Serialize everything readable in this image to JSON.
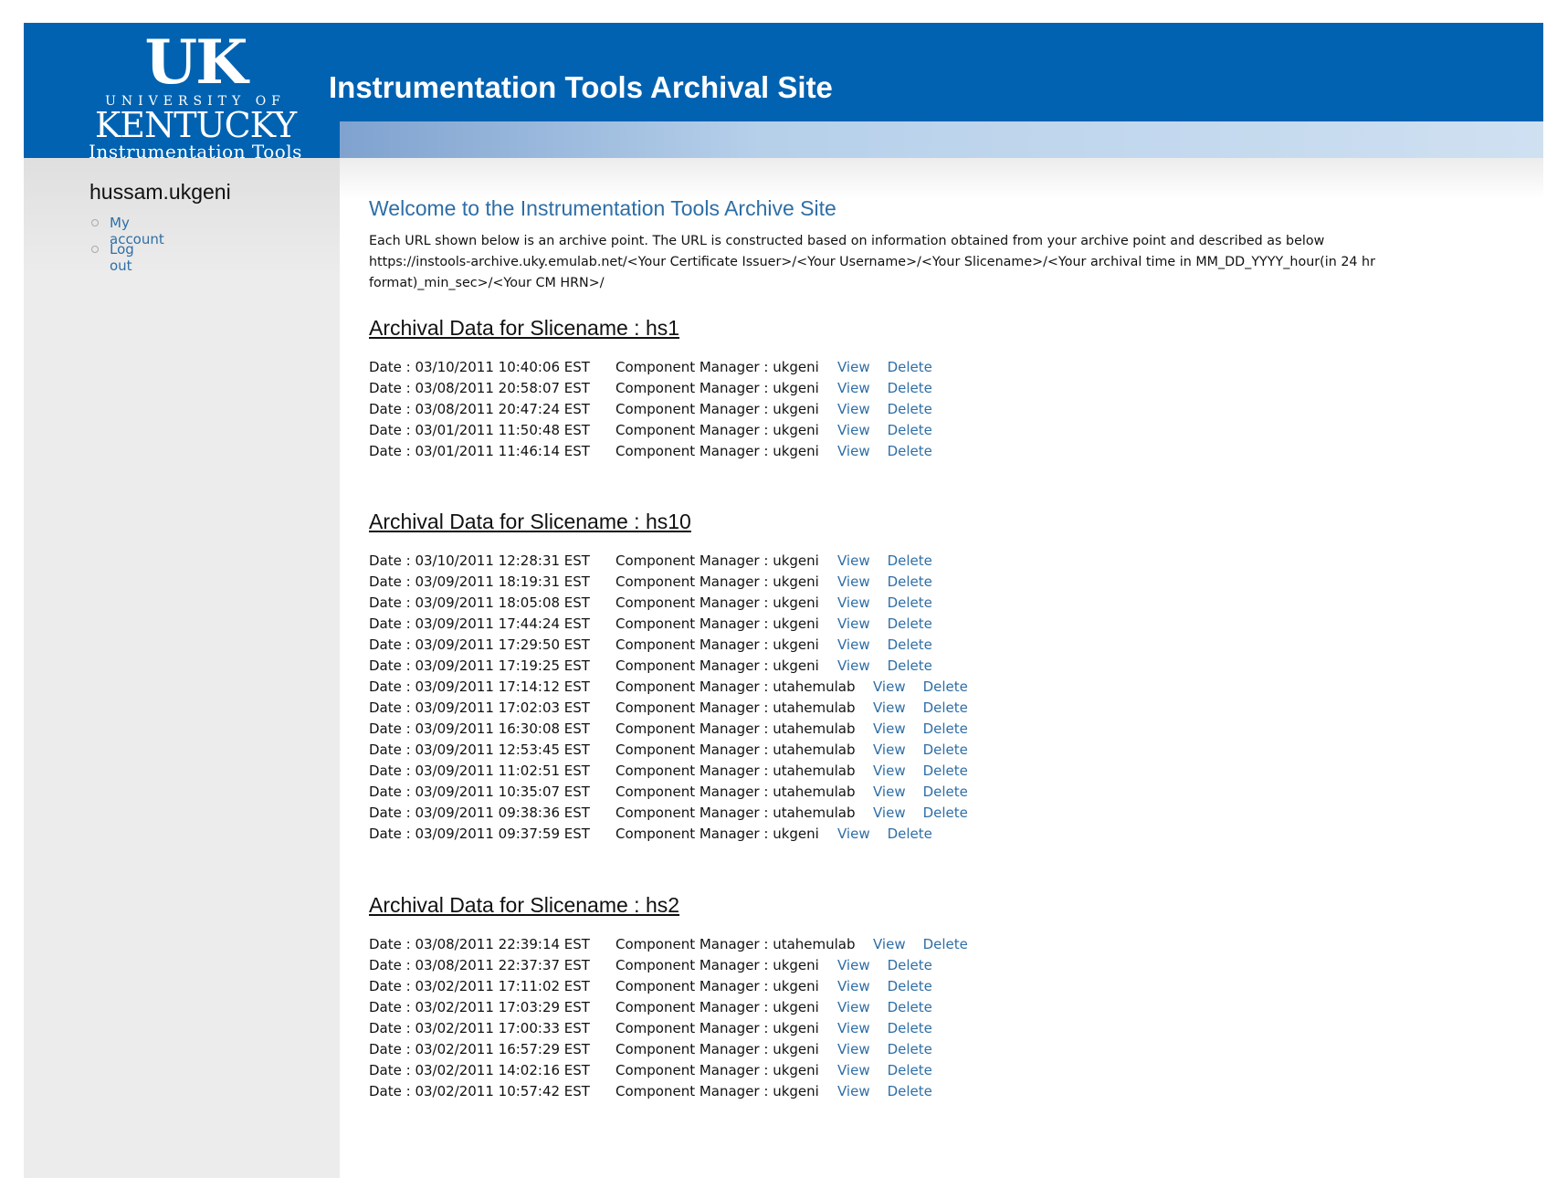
{
  "header": {
    "logo": {
      "mark": "UK",
      "university": "UNIVERSITY OF",
      "state": "KENTUCKY",
      "subtitle": "Instrumentation Tools"
    },
    "site_title": "Instrumentation Tools Archival Site"
  },
  "sidebar": {
    "username": "hussam.ukgeni",
    "menu": [
      {
        "label": "My account"
      },
      {
        "label": "Log out"
      }
    ]
  },
  "main": {
    "welcome": "Welcome to the Instrumentation Tools Archive Site",
    "intro_line1": "Each URL shown below is an archive point. The URL is constructed based on information obtained from your archive point and described as below",
    "intro_line2": "https://instools-archive.uky.emulab.net/<Your Certificate Issuer>/<Your Username>/<Your Slicename>/<Your archival time in MM_DD_YYYY_hour(in 24 hr format)_min_sec>/<Your CM HRN>/",
    "sections": [
      {
        "heading": "Archival Data for Slicename : hs1",
        "rows": [
          {
            "date": "Date : 03/10/2011 10:40:06 EST",
            "cm": "Component Manager : ukgeni",
            "view": "View",
            "delete": "Delete"
          },
          {
            "date": "Date : 03/08/2011 20:58:07 EST",
            "cm": "Component Manager : ukgeni",
            "view": "View",
            "delete": "Delete"
          },
          {
            "date": "Date : 03/08/2011 20:47:24 EST",
            "cm": "Component Manager : ukgeni",
            "view": "View",
            "delete": "Delete"
          },
          {
            "date": "Date : 03/01/2011 11:50:48 EST",
            "cm": "Component Manager : ukgeni",
            "view": "View",
            "delete": "Delete"
          },
          {
            "date": "Date : 03/01/2011 11:46:14 EST",
            "cm": "Component Manager : ukgeni",
            "view": "View",
            "delete": "Delete"
          }
        ]
      },
      {
        "heading": "Archival Data for Slicename : hs10",
        "rows": [
          {
            "date": "Date : 03/10/2011 12:28:31 EST",
            "cm": "Component Manager : ukgeni",
            "view": "View",
            "delete": "Delete"
          },
          {
            "date": "Date : 03/09/2011 18:19:31 EST",
            "cm": "Component Manager : ukgeni",
            "view": "View",
            "delete": "Delete"
          },
          {
            "date": "Date : 03/09/2011 18:05:08 EST",
            "cm": "Component Manager : ukgeni",
            "view": "View",
            "delete": "Delete"
          },
          {
            "date": "Date : 03/09/2011 17:44:24 EST",
            "cm": "Component Manager : ukgeni",
            "view": "View",
            "delete": "Delete"
          },
          {
            "date": "Date : 03/09/2011 17:29:50 EST",
            "cm": "Component Manager : ukgeni",
            "view": "View",
            "delete": "Delete"
          },
          {
            "date": "Date : 03/09/2011 17:19:25 EST",
            "cm": "Component Manager : ukgeni",
            "view": "View",
            "delete": "Delete"
          },
          {
            "date": "Date : 03/09/2011 17:14:12 EST",
            "cm": "Component Manager : utahemulab",
            "view": "View",
            "delete": "Delete"
          },
          {
            "date": "Date : 03/09/2011 17:02:03 EST",
            "cm": "Component Manager : utahemulab",
            "view": "View",
            "delete": "Delete"
          },
          {
            "date": "Date : 03/09/2011 16:30:08 EST",
            "cm": "Component Manager : utahemulab",
            "view": "View",
            "delete": "Delete"
          },
          {
            "date": "Date : 03/09/2011 12:53:45 EST",
            "cm": "Component Manager : utahemulab",
            "view": "View",
            "delete": "Delete"
          },
          {
            "date": "Date : 03/09/2011 11:02:51 EST",
            "cm": "Component Manager : utahemulab",
            "view": "View",
            "delete": "Delete"
          },
          {
            "date": "Date : 03/09/2011 10:35:07 EST",
            "cm": "Component Manager : utahemulab",
            "view": "View",
            "delete": "Delete"
          },
          {
            "date": "Date : 03/09/2011 09:38:36 EST",
            "cm": "Component Manager : utahemulab",
            "view": "View",
            "delete": "Delete"
          },
          {
            "date": "Date : 03/09/2011 09:37:59 EST",
            "cm": "Component Manager : ukgeni",
            "view": "View",
            "delete": "Delete"
          }
        ]
      },
      {
        "heading": "Archival Data for Slicename : hs2",
        "rows": [
          {
            "date": "Date : 03/08/2011 22:39:14 EST",
            "cm": "Component Manager : utahemulab",
            "view": "View",
            "delete": "Delete"
          },
          {
            "date": "Date : 03/08/2011 22:37:37 EST",
            "cm": "Component Manager : ukgeni",
            "view": "View",
            "delete": "Delete"
          },
          {
            "date": "Date : 03/02/2011 17:11:02 EST",
            "cm": "Component Manager : ukgeni",
            "view": "View",
            "delete": "Delete"
          },
          {
            "date": "Date : 03/02/2011 17:03:29 EST",
            "cm": "Component Manager : ukgeni",
            "view": "View",
            "delete": "Delete"
          },
          {
            "date": "Date : 03/02/2011 17:00:33 EST",
            "cm": "Component Manager : ukgeni",
            "view": "View",
            "delete": "Delete"
          },
          {
            "date": "Date : 03/02/2011 16:57:29 EST",
            "cm": "Component Manager : ukgeni",
            "view": "View",
            "delete": "Delete"
          },
          {
            "date": "Date : 03/02/2011 14:02:16 EST",
            "cm": "Component Manager : ukgeni",
            "view": "View",
            "delete": "Delete"
          },
          {
            "date": "Date : 03/02/2011 10:57:42 EST",
            "cm": "Component Manager : ukgeni",
            "view": "View",
            "delete": "Delete"
          }
        ]
      }
    ]
  },
  "colors": {
    "header_blue": "#0062b1",
    "link_blue": "#2e6ea6",
    "sidebar_gray": "#ececec"
  }
}
